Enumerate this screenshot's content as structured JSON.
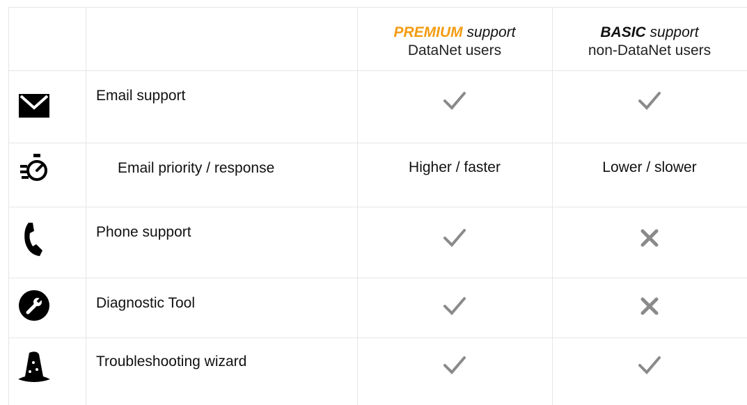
{
  "header": {
    "premium": {
      "tag": "PREMIUM",
      "suffix": " support",
      "audience": "DataNet users"
    },
    "basic": {
      "tag": "BASIC",
      "suffix": " support",
      "audience": "non-DataNet users"
    }
  },
  "rows": [
    {
      "icon": "envelope-icon",
      "label": "Email support",
      "premium": "check",
      "basic": "check"
    },
    {
      "icon": "timer-icon",
      "label": "Email priority / response",
      "premium_text": "Higher / faster",
      "basic_text": "Lower / slower"
    },
    {
      "icon": "phone-icon",
      "label": "Phone support",
      "premium": "check",
      "basic": "cross"
    },
    {
      "icon": "wrench-icon",
      "label": "Diagnostic Tool",
      "premium": "check",
      "basic": "cross"
    },
    {
      "icon": "wizard-hat-icon",
      "label": "Troubleshooting wizard",
      "premium": "check",
      "basic": "check"
    }
  ],
  "colors": {
    "accent": "#f39c12",
    "grid": "#e6e6e6",
    "mark": "#8a8a8a"
  }
}
